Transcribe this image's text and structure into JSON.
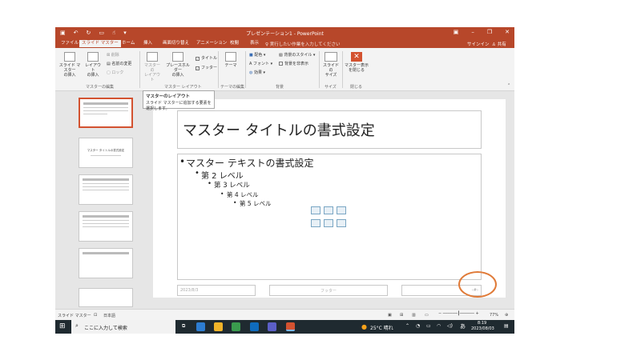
{
  "window": {
    "doc_title": "プレゼンテーション1 - PowerPoint",
    "controls": [
      "–",
      "❐",
      "✕"
    ]
  },
  "tabs": [
    {
      "label": "ファイル",
      "active": false
    },
    {
      "label": "スライド マスター",
      "active": true
    },
    {
      "label": "ホーム",
      "active": false
    },
    {
      "label": "挿入",
      "active": false
    },
    {
      "label": "画面切り替え",
      "active": false
    },
    {
      "label": "アニメーション",
      "active": false
    },
    {
      "label": "校閲",
      "active": false
    },
    {
      "label": "表示",
      "active": false
    }
  ],
  "tell_me": "実行したい作業を入力してください",
  "signin": "サインイン",
  "share": "共有",
  "ribbon": {
    "insert_master": "スライド マスター\nの挿入",
    "insert_layout": "レイアウト\nの挿入",
    "delete": "削除",
    "rename": "名前の変更",
    "preserve": "ロック",
    "group_edit_master": "マスターの編集",
    "master_layout": "マスターの\nレイアウト",
    "insert_placeholder": "プレースホルダー\nの挿入",
    "title_chk": "タイトル",
    "footer_chk": "フッター",
    "group_master_layout": "マスター レイアウト",
    "theme": "テーマ",
    "group_edit_theme": "テーマの編集",
    "colors": "配色",
    "fonts": "フォント",
    "effects": "効果",
    "bg_styles": "背景のスタイル",
    "hide_bg": "背景を非表示",
    "group_background": "背景",
    "slide_size": "スライドの\nサイズ",
    "group_size": "サイズ",
    "close_master": "マスター表示\nを閉じる",
    "group_close": "閉じる"
  },
  "tooltip": {
    "title": "マスターのレイアウト",
    "body": "スライド マスターに追加する要素を選択します。"
  },
  "slide": {
    "title": "マスター タイトルの書式設定",
    "bullets": [
      {
        "text": "マスター テキストの書式設定",
        "level": 1
      },
      {
        "text": "第 2 レベル",
        "level": 2
      },
      {
        "text": "第 3 レベル",
        "level": 3
      },
      {
        "text": "第 4 レベル",
        "level": 4
      },
      {
        "text": "第 5 レベル",
        "level": 5
      }
    ],
    "date": "2023/8/3",
    "footer": "フッター",
    "number": "‹#›"
  },
  "thumbnail_title": "マスター タイトルの書式設定",
  "statusbar": {
    "view": "スライド マスター",
    "language": "日本語",
    "zoom": "77%"
  },
  "taskbar": {
    "search_placeholder": "ここに入力して検索",
    "weather": "25°C 晴れ",
    "ime": "あ",
    "time": "8:19",
    "date": "2023/08/03"
  },
  "colors": {
    "accent": "#b7472a",
    "highlight_circle": "#e07b39"
  }
}
